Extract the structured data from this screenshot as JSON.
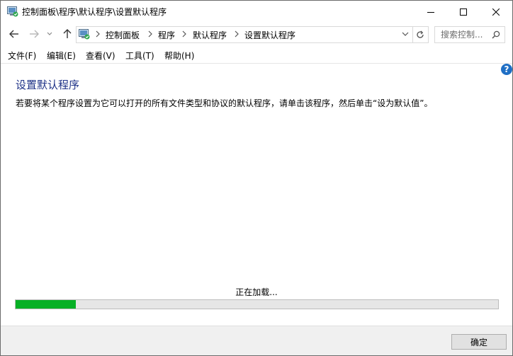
{
  "window": {
    "title": "控制面板\\程序\\默认程序\\设置默认程序"
  },
  "address_bar": {
    "breadcrumbs": [
      "控制面板",
      "程序",
      "默认程序",
      "设置默认程序"
    ]
  },
  "search": {
    "placeholder": "搜索控制..."
  },
  "menu": {
    "items": [
      "文件(F)",
      "编辑(E)",
      "查看(V)",
      "工具(T)",
      "帮助(H)"
    ]
  },
  "content": {
    "help_glyph": "?",
    "heading": "设置默认程序",
    "description": "若要将某个程序设置为它可以打开的所有文件类型和协议的默认程序，请单击该程序，然后单击“设为默认值”。",
    "loading_text": "正在加载...",
    "progress_fraction": 0.125
  },
  "footer": {
    "ok_label": "确定"
  },
  "colors": {
    "accent": "#1e3287",
    "progress": "#06b025",
    "help": "#1f6fc5"
  }
}
